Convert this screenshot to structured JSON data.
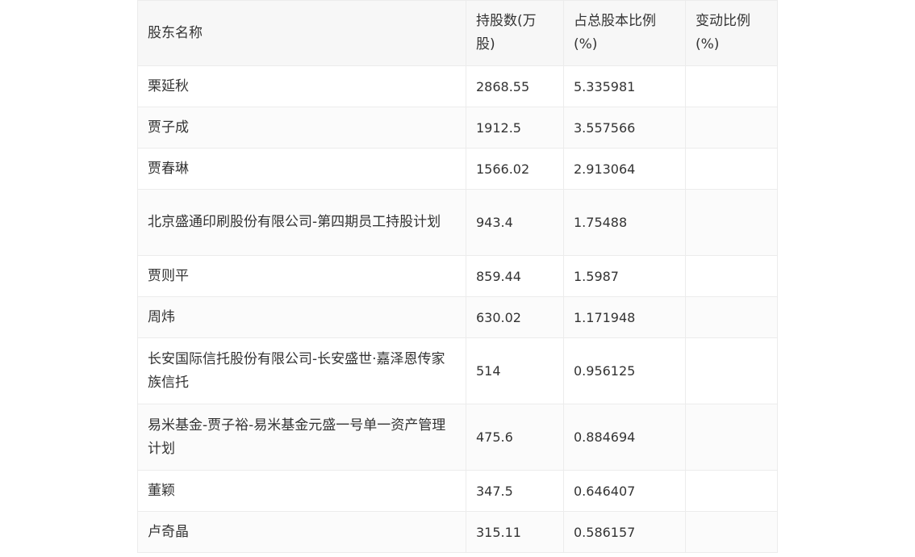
{
  "table": {
    "headers": [
      "股东名称",
      "持股数(万股)",
      "占总股本比例(%)",
      "变动比例(%)"
    ],
    "rows": [
      {
        "name": "栗延秋",
        "shares": "2868.55",
        "ratio": "5.335981",
        "change": ""
      },
      {
        "name": "贾子成",
        "shares": "1912.5",
        "ratio": "3.557566",
        "change": ""
      },
      {
        "name": "贾春琳",
        "shares": "1566.02",
        "ratio": "2.913064",
        "change": ""
      },
      {
        "name": "北京盛通印刷股份有限公司-第四期员工持股计划",
        "shares": "943.4",
        "ratio": "1.75488",
        "change": ""
      },
      {
        "name": "贾则平",
        "shares": "859.44",
        "ratio": "1.5987",
        "change": ""
      },
      {
        "name": "周炜",
        "shares": "630.02",
        "ratio": "1.171948",
        "change": ""
      },
      {
        "name": "长安国际信托股份有限公司-长安盛世·嘉泽恩传家族信托",
        "shares": "514",
        "ratio": "0.956125",
        "change": ""
      },
      {
        "name": "易米基金-贾子裕-易米基金元盛一号单一资产管理计划",
        "shares": "475.6",
        "ratio": "0.884694",
        "change": ""
      },
      {
        "name": "董颖",
        "shares": "347.5",
        "ratio": "0.646407",
        "change": ""
      },
      {
        "name": "卢奇晶",
        "shares": "315.11",
        "ratio": "0.586157",
        "change": ""
      }
    ]
  },
  "colors": {
    "header_bg": "#f7f7f7",
    "border": "#ececec",
    "text": "#333333"
  }
}
